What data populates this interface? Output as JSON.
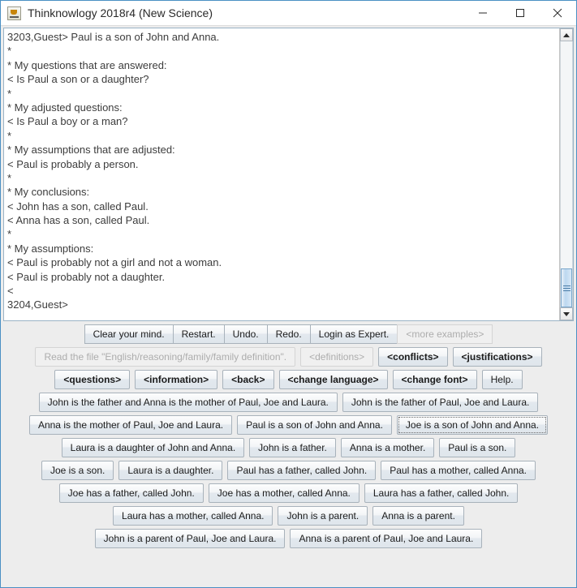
{
  "window": {
    "title": "Thinknowlogy 2018r4 (New Science)",
    "icon": "java-coffee-cup-icon",
    "controls": {
      "minimize": "minimize-icon",
      "maximize": "maximize-icon",
      "close": "close-icon"
    },
    "accent_border": "#4a90c4"
  },
  "console": {
    "lines": [
      "3203,Guest> Paul is a son of John and Anna.",
      "*",
      "* My questions that are answered:",
      "< Is Paul a son or a daughter?",
      "*",
      "* My adjusted questions:",
      "< Is Paul a boy or a man?",
      "*",
      "* My assumptions that are adjusted:",
      "< Paul is probably a person.",
      "*",
      "* My conclusions:",
      "< John has a son, called Paul.",
      "< Anna has a son, called Paul.",
      "*",
      "* My assumptions:",
      "< Paul is probably not a girl and not a woman.",
      "< Paul is probably not a daughter.",
      "<",
      "3204,Guest>"
    ],
    "scrollbar": {
      "up_arrow": "scroll-up-arrow-icon",
      "down_arrow": "scroll-down-arrow-icon",
      "thumb_position": "bottom"
    }
  },
  "toolbar_rows": [
    {
      "name": "control-row",
      "joined": true,
      "buttons": [
        {
          "label": "Clear your mind.",
          "enabled": true,
          "bold": false,
          "focused": false,
          "name": "clear-your-mind-button"
        },
        {
          "label": "Restart.",
          "enabled": true,
          "bold": false,
          "focused": false,
          "name": "restart-button"
        },
        {
          "label": "Undo.",
          "enabled": true,
          "bold": false,
          "focused": false,
          "name": "undo-button"
        },
        {
          "label": "Redo.",
          "enabled": true,
          "bold": false,
          "focused": false,
          "name": "redo-button"
        },
        {
          "label": "Login as Expert.",
          "enabled": true,
          "bold": false,
          "focused": false,
          "name": "login-as-expert-button"
        },
        {
          "label": "<more examples>",
          "enabled": false,
          "bold": false,
          "focused": false,
          "name": "more-examples-button"
        }
      ]
    },
    {
      "name": "file-row",
      "joined": false,
      "buttons": [
        {
          "label": "Read the file \"English/reasoning/family/family definition\".",
          "enabled": false,
          "bold": false,
          "focused": false,
          "name": "read-file-button"
        },
        {
          "label": "<definitions>",
          "enabled": false,
          "bold": false,
          "focused": false,
          "name": "definitions-button"
        },
        {
          "label": "<conflicts>",
          "enabled": true,
          "bold": true,
          "focused": false,
          "name": "conflicts-button"
        },
        {
          "label": "<justifications>",
          "enabled": true,
          "bold": true,
          "focused": false,
          "name": "justifications-button"
        }
      ]
    },
    {
      "name": "navigation-row",
      "joined": false,
      "buttons": [
        {
          "label": "<questions>",
          "enabled": true,
          "bold": true,
          "focused": false,
          "name": "questions-button"
        },
        {
          "label": "<information>",
          "enabled": true,
          "bold": true,
          "focused": false,
          "name": "information-button"
        },
        {
          "label": "<back>",
          "enabled": true,
          "bold": true,
          "focused": false,
          "name": "back-button"
        },
        {
          "label": "<change language>",
          "enabled": true,
          "bold": true,
          "focused": false,
          "name": "change-language-button"
        },
        {
          "label": "<change font>",
          "enabled": true,
          "bold": true,
          "focused": false,
          "name": "change-font-button"
        },
        {
          "label": "Help.",
          "enabled": true,
          "bold": false,
          "focused": false,
          "name": "help-button"
        }
      ]
    },
    {
      "name": "sentence-row-1",
      "joined": false,
      "buttons": [
        {
          "label": "John is the father and Anna is the mother of Paul, Joe and Laura.",
          "enabled": true,
          "bold": false,
          "focused": false,
          "name": "sentence-button"
        },
        {
          "label": "John is the father of Paul, Joe and Laura.",
          "enabled": true,
          "bold": false,
          "focused": false,
          "name": "sentence-button"
        }
      ]
    },
    {
      "name": "sentence-row-2",
      "joined": false,
      "buttons": [
        {
          "label": "Anna is the mother of Paul, Joe and Laura.",
          "enabled": true,
          "bold": false,
          "focused": false,
          "name": "sentence-button"
        },
        {
          "label": "Paul is a son of John and Anna.",
          "enabled": true,
          "bold": false,
          "focused": false,
          "name": "sentence-button"
        },
        {
          "label": "Joe is a son of John and Anna.",
          "enabled": true,
          "bold": false,
          "focused": true,
          "name": "sentence-button"
        }
      ]
    },
    {
      "name": "sentence-row-3",
      "joined": false,
      "buttons": [
        {
          "label": "Laura is a daughter of John and Anna.",
          "enabled": true,
          "bold": false,
          "focused": false,
          "name": "sentence-button"
        },
        {
          "label": "John is a father.",
          "enabled": true,
          "bold": false,
          "focused": false,
          "name": "sentence-button"
        },
        {
          "label": "Anna is a mother.",
          "enabled": true,
          "bold": false,
          "focused": false,
          "name": "sentence-button"
        },
        {
          "label": "Paul is a son.",
          "enabled": true,
          "bold": false,
          "focused": false,
          "name": "sentence-button"
        }
      ]
    },
    {
      "name": "sentence-row-4",
      "joined": false,
      "buttons": [
        {
          "label": "Joe is a son.",
          "enabled": true,
          "bold": false,
          "focused": false,
          "name": "sentence-button"
        },
        {
          "label": "Laura is a daughter.",
          "enabled": true,
          "bold": false,
          "focused": false,
          "name": "sentence-button"
        },
        {
          "label": "Paul has a father, called John.",
          "enabled": true,
          "bold": false,
          "focused": false,
          "name": "sentence-button"
        },
        {
          "label": "Paul has a mother, called Anna.",
          "enabled": true,
          "bold": false,
          "focused": false,
          "name": "sentence-button"
        }
      ]
    },
    {
      "name": "sentence-row-5",
      "joined": false,
      "buttons": [
        {
          "label": "Joe has a father, called John.",
          "enabled": true,
          "bold": false,
          "focused": false,
          "name": "sentence-button"
        },
        {
          "label": "Joe has a mother, called Anna.",
          "enabled": true,
          "bold": false,
          "focused": false,
          "name": "sentence-button"
        },
        {
          "label": "Laura has a father, called John.",
          "enabled": true,
          "bold": false,
          "focused": false,
          "name": "sentence-button"
        }
      ]
    },
    {
      "name": "sentence-row-6",
      "joined": false,
      "buttons": [
        {
          "label": "Laura has a mother, called Anna.",
          "enabled": true,
          "bold": false,
          "focused": false,
          "name": "sentence-button"
        },
        {
          "label": "John is a parent.",
          "enabled": true,
          "bold": false,
          "focused": false,
          "name": "sentence-button"
        },
        {
          "label": "Anna is a parent.",
          "enabled": true,
          "bold": false,
          "focused": false,
          "name": "sentence-button"
        }
      ]
    },
    {
      "name": "sentence-row-7",
      "joined": false,
      "buttons": [
        {
          "label": "John is a parent of Paul, Joe and Laura.",
          "enabled": true,
          "bold": false,
          "focused": false,
          "name": "sentence-button"
        },
        {
          "label": "Anna is a parent of Paul, Joe and Laura.",
          "enabled": true,
          "bold": false,
          "focused": false,
          "name": "sentence-button"
        }
      ]
    }
  ]
}
